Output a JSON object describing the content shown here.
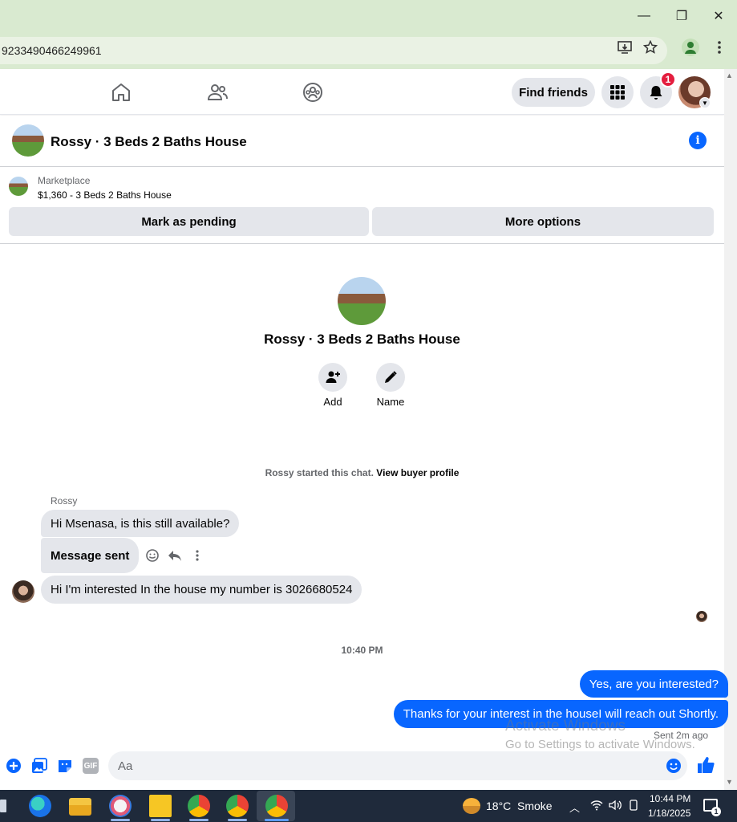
{
  "browser": {
    "url": "9233490466249961",
    "window_buttons": {
      "minimize": "—",
      "maximize": "❐",
      "close": "✕"
    }
  },
  "topnav": {
    "find_friends_label": "Find friends",
    "notification_count": "1"
  },
  "chat": {
    "title": "Rossy · 3 Beds 2 Baths House"
  },
  "marketplace": {
    "label": "Marketplace",
    "listing": "$1,360 - 3 Beds 2 Baths House",
    "mark_pending_label": "Mark as pending",
    "more_options_label": "More options"
  },
  "intro": {
    "title": "Rossy · 3 Beds 2 Baths House",
    "add_label": "Add",
    "name_label": "Name"
  },
  "system_message": {
    "text": "Rossy started this chat. ",
    "link": "View buyer profile"
  },
  "messages": {
    "sender_name": "Rossy",
    "incoming": [
      "Hi Msenasa, is this still available?",
      "Message sent",
      "Hi I'm interested In the house my number is 3026680524"
    ],
    "timestamp": "10:40 PM",
    "outgoing": [
      "Yes, are you interested?",
      "Thanks for your interest in the houseI will reach out Shortly."
    ],
    "sent_status": "Sent 2m ago"
  },
  "watermark": {
    "line1": "Activate Windows",
    "line2": "Go to Settings to activate Windows."
  },
  "composer": {
    "placeholder": "Aa",
    "gif_label": "GIF"
  },
  "taskbar": {
    "weather_temp": "18°C",
    "weather_desc": "Smoke",
    "time": "10:44 PM",
    "date": "1/18/2025",
    "notification_count": "1"
  },
  "colors": {
    "accent": "#0866ff",
    "bubble_in": "#e4e6eb",
    "badge": "#e41e3f",
    "titlebar": "#d9ead0",
    "taskbar": "#1f2a3b"
  }
}
